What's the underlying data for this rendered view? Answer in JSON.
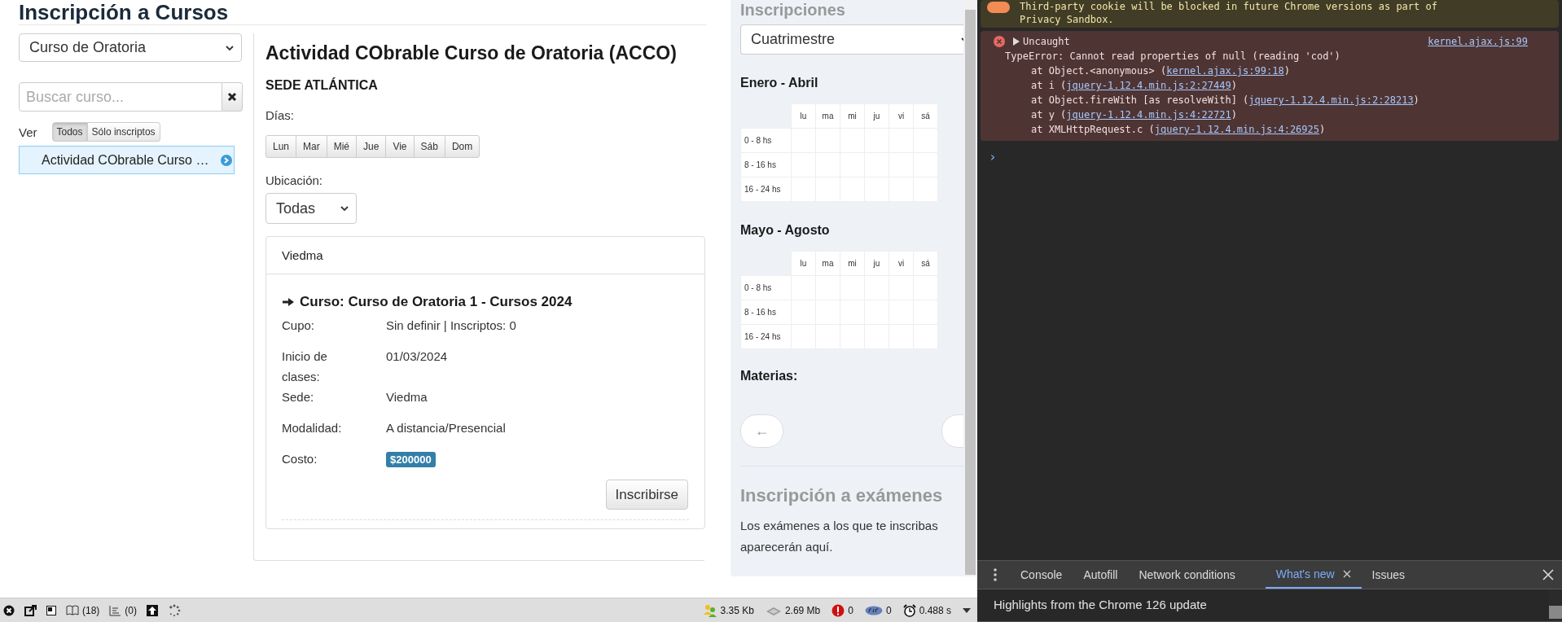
{
  "page": {
    "title": "Inscripción a Cursos",
    "course_select": {
      "value": "Curso de Oratoria"
    },
    "search": {
      "placeholder": "Buscar curso..."
    },
    "filter": {
      "label": "Ver",
      "options": [
        {
          "label": "Todos",
          "selected": true
        },
        {
          "label": "Sólo inscriptos",
          "selected": false
        }
      ]
    },
    "courses": [
      {
        "label": "Actividad CObrable Curso …",
        "selected": true
      }
    ],
    "detail": {
      "title": "Actividad CObrable Curso de Oratoria (ACCO)",
      "sede": "SEDE ATLÁNTICA",
      "days_label": "Días:",
      "days": [
        "Lun",
        "Mar",
        "Mié",
        "Jue",
        "Vie",
        "Sáb",
        "Dom"
      ],
      "location_label": "Ubicación:",
      "location_select": {
        "value": "Todas"
      },
      "panel": {
        "header": "Viedma",
        "course_title": "Curso: Curso de Oratoria 1 - Cursos 2024",
        "fields": [
          {
            "label": "Cupo:",
            "value": "Sin definir | Inscriptos: 0",
            "kind": "text"
          },
          {
            "label": "Inicio de clases:",
            "value": "01/03/2024",
            "kind": "text"
          },
          {
            "label": "Sede:",
            "value": "Viedma",
            "kind": "text"
          },
          {
            "label": "Modalidad:",
            "value": "A distancia/Presencial",
            "kind": "text"
          },
          {
            "label": "Costo:",
            "value": "$200000",
            "kind": "badge"
          }
        ],
        "button": "Inscribirse"
      }
    }
  },
  "sidebar": {
    "title": "Inscripciones",
    "period_select": {
      "value": "Cuatrimestre"
    },
    "schedules": [
      {
        "title": "Enero - Abril",
        "days": [
          "lu",
          "ma",
          "mi",
          "ju",
          "vi",
          "sá"
        ],
        "slots": [
          "0 - 8 hs",
          "8 - 16 hs",
          "16 - 24 hs"
        ]
      },
      {
        "title": "Mayo - Agosto",
        "days": [
          "lu",
          "ma",
          "mi",
          "ju",
          "vi",
          "sá"
        ],
        "slots": [
          "0 - 8 hs",
          "8 - 16 hs",
          "16 - 24 hs"
        ]
      }
    ],
    "subjects_label": "Materias:",
    "prev_button": "←",
    "exams_title": "Inscripción a exámenes",
    "exams_text": "Los exámenes a los que te inscribas aparecerán aquí."
  },
  "debug_bar": {
    "left": [
      {
        "kind": "close"
      },
      {
        "kind": "popout"
      },
      {
        "kind": "window"
      },
      {
        "kind": "book",
        "text": "(18)"
      },
      {
        "kind": "list",
        "text": "(0)"
      },
      {
        "kind": "upload"
      },
      {
        "kind": "spinner"
      }
    ],
    "right": [
      {
        "kind": "users",
        "text": "3.35 Kb"
      },
      {
        "kind": "disk",
        "text": "2.69 Mb"
      },
      {
        "kind": "error",
        "text": "0"
      },
      {
        "kind": "php",
        "text": "0"
      },
      {
        "kind": "clock",
        "text": "0.488 s"
      },
      {
        "kind": "caret"
      }
    ]
  },
  "devtools": {
    "messages": [
      {
        "kind": "warning",
        "text": "Third-party cookie will be blocked in future Chrome versions as part of Privacy Sandbox."
      },
      {
        "kind": "error",
        "summary": "Uncaught",
        "source": "kernel.ajax.js:99",
        "message": "TypeError: Cannot read properties of null (reading 'cod')",
        "stack": [
          {
            "before": "at Object.<anonymous> (",
            "link": "kernel.ajax.js:99:18",
            "after": ")"
          },
          {
            "before": "at i (",
            "link": "jquery-1.12.4.min.js:2:27449",
            "after": ")"
          },
          {
            "before": "at Object.fireWith [as resolveWith] (",
            "link": "jquery-1.12.4.min.js:2:28213",
            "after": ")"
          },
          {
            "before": "at y (",
            "link": "jquery-1.12.4.min.js:4:22721",
            "after": ")"
          },
          {
            "before": "at XMLHttpRequest.c (",
            "link": "jquery-1.12.4.min.js:4:26925",
            "after": ")"
          }
        ]
      }
    ],
    "prompt": "›",
    "drawer_tabs": [
      {
        "label": "Console",
        "selected": false,
        "closable": false
      },
      {
        "label": "Autofill",
        "selected": false,
        "closable": false
      },
      {
        "label": "Network conditions",
        "selected": false,
        "closable": false
      },
      {
        "label": "What's new",
        "selected": true,
        "closable": true
      },
      {
        "label": "Issues",
        "selected": false,
        "closable": false
      }
    ],
    "drawer_content": "Highlights from the Chrome 126 update"
  }
}
